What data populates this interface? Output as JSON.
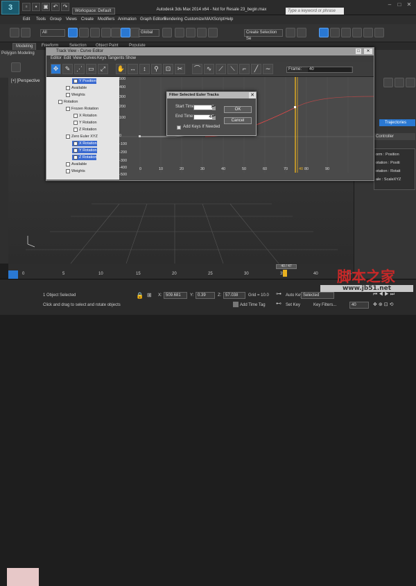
{
  "app": {
    "logo": "3",
    "title": "Autodesk 3ds Max 2014 x64 - Not for Resale  23_begin.max",
    "workspace": "Workspace: Default",
    "help_search_placeholder": "Type a keyword or phrase"
  },
  "menu": [
    "Edit",
    "Tools",
    "Group",
    "Views",
    "Create",
    "Modifiers",
    "Animation",
    "Graph Editors",
    "Rendering",
    "Customize",
    "MAXScript",
    "Help"
  ],
  "toolbar": {
    "filter": "All",
    "coord": "Global",
    "selection_set": "Create Selection Se"
  },
  "ribbon": {
    "tabs": [
      "Modeling",
      "Freeform",
      "Selection",
      "Object Paint",
      "Populate"
    ],
    "active_tab": "Modeling",
    "panel_label": "Polygon Modeling"
  },
  "viewport": {
    "label": "[+] [Perspective"
  },
  "trackview": {
    "title": "Track View - Curve Editor",
    "menu": [
      "Editor",
      "Edit",
      "View",
      "Curves",
      "Keys",
      "Tangents",
      "Show"
    ],
    "frame_label": "Frame:",
    "frame_value": "40",
    "tree": [
      {
        "label": "Y Position",
        "indent": 3,
        "selected": true
      },
      {
        "label": "Available",
        "indent": 2,
        "selected": false
      },
      {
        "label": "Weights",
        "indent": 2,
        "selected": false
      },
      {
        "label": "Rotation",
        "indent": 1,
        "selected": false
      },
      {
        "label": "Frozen Rotation",
        "indent": 2,
        "selected": false
      },
      {
        "label": "X Rotation",
        "indent": 3,
        "selected": false
      },
      {
        "label": "Y Rotation",
        "indent": 3,
        "selected": false
      },
      {
        "label": "Z Rotation",
        "indent": 3,
        "selected": false
      },
      {
        "label": "Zero Euler XYZ",
        "indent": 2,
        "selected": false
      },
      {
        "label": "X Rotation",
        "indent": 3,
        "selected": true
      },
      {
        "label": "Y Rotation",
        "indent": 3,
        "selected": true
      },
      {
        "label": "Z Rotation",
        "indent": 3,
        "selected": true
      },
      {
        "label": "Available",
        "indent": 2,
        "selected": false
      },
      {
        "label": "Weights",
        "indent": 2,
        "selected": false
      }
    ],
    "y_ticks": [
      "500",
      "400",
      "300",
      "200",
      "100",
      "0",
      "-100",
      "-200",
      "-300",
      "-400",
      "-500"
    ],
    "x_ticks": [
      "0",
      "10",
      "20",
      "30",
      "40",
      "50",
      "60",
      "70",
      "80",
      "90"
    ]
  },
  "dialog": {
    "title": "Filter Selected Euler Tracks",
    "start_label": "Start Time:",
    "start_value": "0",
    "end_label": "End Time:",
    "end_value": "40",
    "checkbox_label": "Add Keys If Needed",
    "ok": "OK",
    "cancel": "Cancel"
  },
  "right_panel": {
    "trajectories": "Trajectories",
    "controller_header": "Controller",
    "controller_items": [
      "orm : Position",
      "otation : Positi",
      "otation : Rotati",
      "ale : ScaleXYZ"
    ]
  },
  "timeline": {
    "slider": "40 / 47",
    "ticks": [
      "0",
      "5",
      "10",
      "15",
      "20",
      "25",
      "30",
      "35",
      "40",
      "45"
    ]
  },
  "status": {
    "selected": "1 Object Selected",
    "prompt": "Click and drag to select and rotate objects",
    "x": "509.681",
    "y": "0.39",
    "z": "57.038",
    "grid": "Grid = 10.0",
    "auto_key": "Auto Key",
    "auto_key_value": "Selected",
    "set_key": "Set Key",
    "key_filters": "Key Filters...",
    "frame": "40",
    "add_time_tag": "Add Time Tag"
  },
  "watermark": {
    "text": "脚本之家",
    "url": "www.jb51.net"
  },
  "colors": {
    "accent_blue": "#2a78d2",
    "curve_red": "#e04848",
    "key_orange": "#e8b020"
  }
}
